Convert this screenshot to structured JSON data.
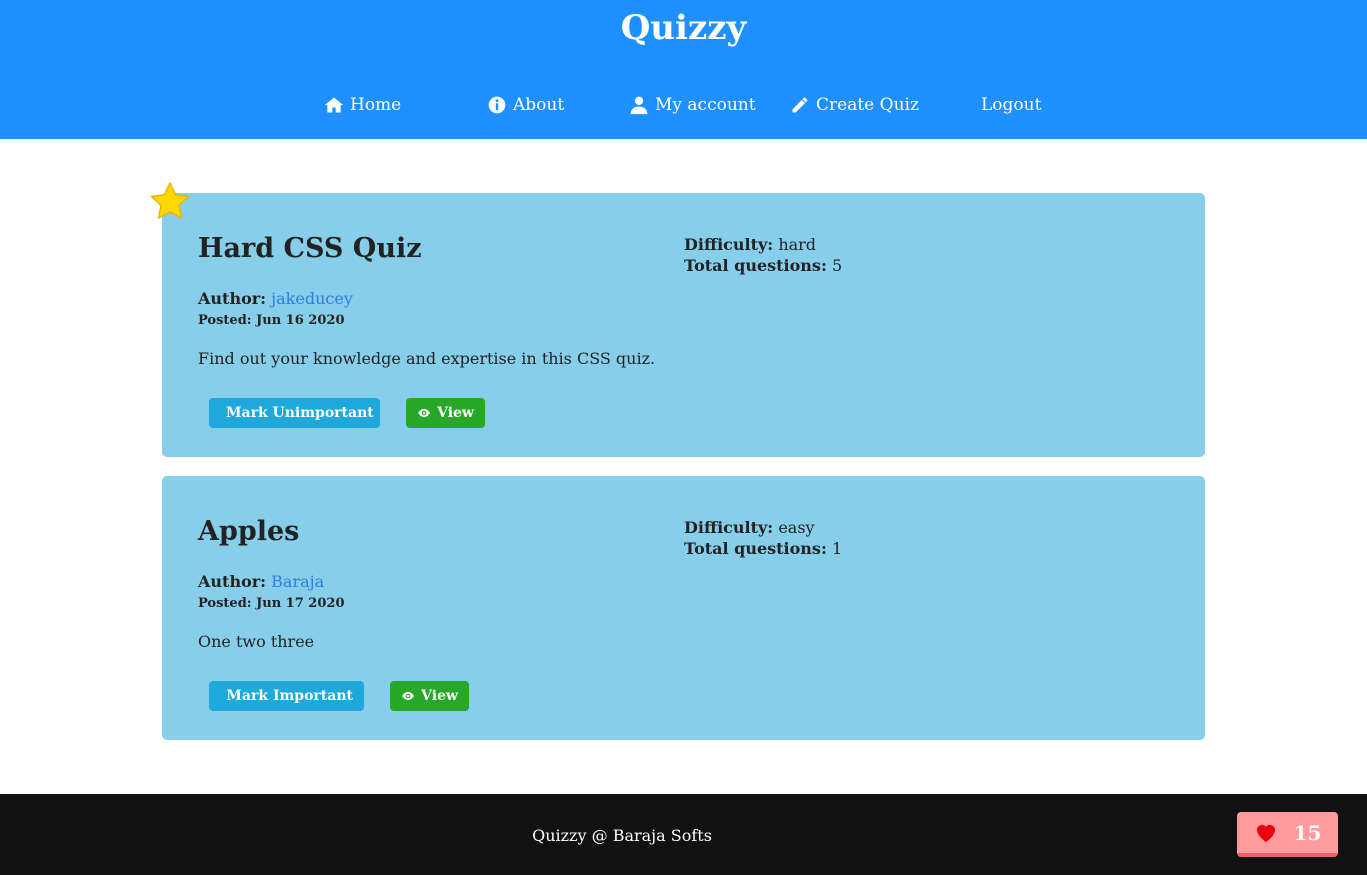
{
  "header": {
    "title": "Quizzy",
    "nav": [
      {
        "label": "Home",
        "icon": "home-icon"
      },
      {
        "label": "About",
        "icon": "info-icon"
      },
      {
        "label": "My account",
        "icon": "user-icon"
      },
      {
        "label": "Create Quiz",
        "icon": "pencil-icon"
      },
      {
        "label": "Logout",
        "icon": ""
      }
    ]
  },
  "quizzes": [
    {
      "title": "Hard CSS Quiz",
      "author_label": "Author:",
      "author": "jakeducey",
      "posted": "Posted: Jun 16 2020",
      "description": "Find out your knowledge and expertise in this CSS quiz.",
      "difficulty_label": "Difficulty:",
      "difficulty": "hard",
      "total_label": "Total questions:",
      "total": "5",
      "important": true,
      "mark_button": "Mark Unimportant",
      "view_button": "View"
    },
    {
      "title": "Apples",
      "author_label": "Author:",
      "author": "Baraja",
      "posted": "Posted: Jun 17 2020",
      "description": "One two three",
      "difficulty_label": "Difficulty:",
      "difficulty": "easy",
      "total_label": "Total questions:",
      "total": "1",
      "important": false,
      "mark_button": "Mark Important",
      "view_button": "View"
    }
  ],
  "footer": {
    "text": "Quizzy @ Baraja Softs",
    "likes": "15"
  },
  "colors": {
    "header": "#1e90ff",
    "card": "#87ceeb",
    "button_blue": "#1fa8dc",
    "button_green": "#28a828",
    "footer": "#111111",
    "like_badge": "#ff9a9e"
  }
}
